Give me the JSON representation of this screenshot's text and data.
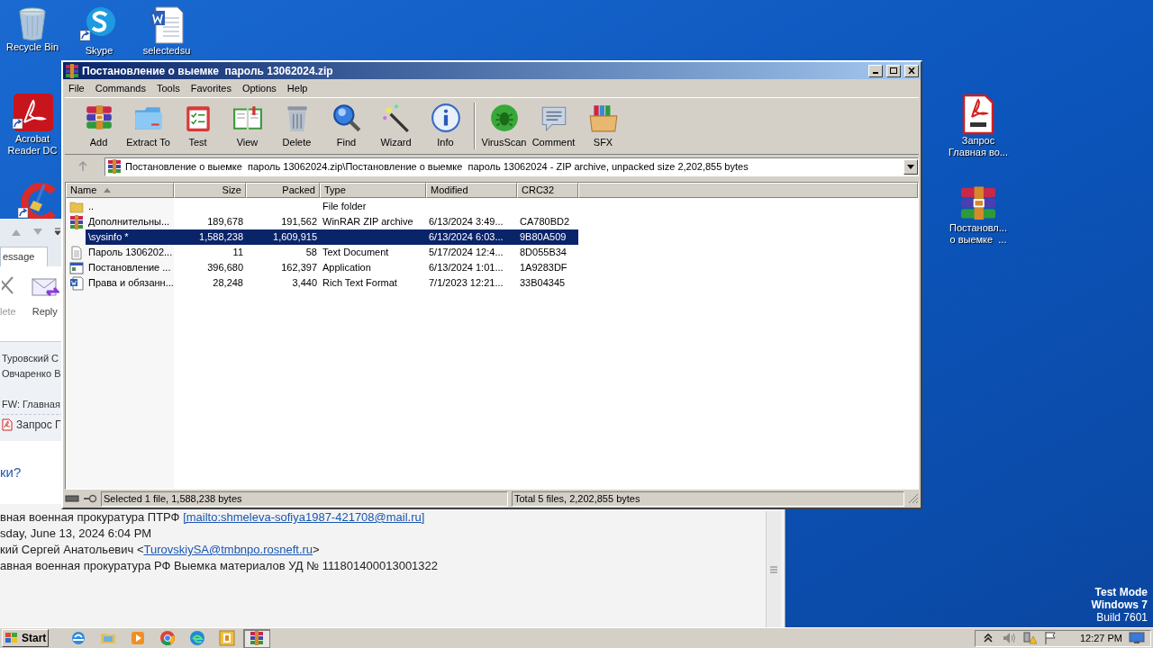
{
  "desktop_icons": [
    {
      "kind": "recycle",
      "lines": [
        "Recycle Bin"
      ]
    },
    {
      "kind": "skype",
      "lines": [
        "Skype"
      ]
    },
    {
      "kind": "word",
      "lines": [
        "selectedsu"
      ]
    },
    {
      "kind": "acrobat",
      "lines": [
        "Acrobat",
        "Reader DC"
      ]
    },
    {
      "kind": "ccleaner"
    },
    {
      "kind": "pdf",
      "lines": [
        "Запрос",
        "Главная во..."
      ]
    },
    {
      "kind": "rar",
      "lines": [
        "Постановл...",
        "о выемке  ..."
      ]
    }
  ],
  "mail_window": {
    "tabs": [
      {
        "label": "essage",
        "selected": true
      }
    ],
    "ribbon": [
      {
        "kind": "delete",
        "label": "lete"
      },
      {
        "kind": "reply",
        "label": "Reply"
      }
    ],
    "recipients": [
      "Туровский С",
      "Овчаренко В"
    ],
    "subject": "FW: Главная",
    "attachment": "Запрос Г",
    "heading": "ки?",
    "body": [
      {
        "text": "вная военная прокуратура ПТРФ ",
        "link": "[mailto:shmeleva-sofiya1987-421708@mail.ru]"
      },
      {
        "text": "sday, June 13, 2024 6:04 PM"
      },
      {
        "text": "кий Сергей Анатольевич <",
        "link": "TurovskiySA@tmbnpo.rosneft.ru",
        "after": ">"
      },
      {
        "text": "авная военная прокуратура РФ Выемка материалов УД № 111801400013001322"
      }
    ]
  },
  "archive_window": {
    "title": "Постановление о выемке  пароль 13062024.zip",
    "menu": [
      "File",
      "Commands",
      "Tools",
      "Favorites",
      "Options",
      "Help"
    ],
    "toolbar": [
      {
        "kind": "add",
        "label": "Add",
        "separator_before": false
      },
      {
        "kind": "extract",
        "label": "Extract To",
        "separator_before": false
      },
      {
        "kind": "test",
        "label": "Test",
        "separator_before": false
      },
      {
        "kind": "view",
        "label": "View",
        "separator_before": false
      },
      {
        "kind": "delete",
        "label": "Delete",
        "separator_before": false
      },
      {
        "kind": "find",
        "label": "Find",
        "separator_before": false
      },
      {
        "kind": "wizard",
        "label": "Wizard",
        "separator_before": false
      },
      {
        "kind": "info",
        "label": "Info",
        "separator_before": false
      },
      {
        "kind": "virus",
        "label": "VirusScan",
        "separator_before": true
      },
      {
        "kind": "comment",
        "label": "Comment",
        "separator_before": false
      },
      {
        "kind": "sfx",
        "label": "SFX",
        "separator_before": false
      }
    ],
    "address": "Постановление о выемке  пароль 13062024.zip\\Постановление о выемке  пароль 13062024 - ZIP archive, unpacked size 2,202,855 bytes",
    "columns": [
      {
        "label": "Name",
        "sorted": true
      },
      {
        "label": "Size",
        "sorted": false
      },
      {
        "label": "Packed",
        "sorted": false
      },
      {
        "label": "Type",
        "sorted": false
      },
      {
        "label": "Modified",
        "sorted": false
      },
      {
        "label": "CRC32",
        "sorted": false
      }
    ],
    "rows": [
      {
        "kind": "folder",
        "cells": [
          "..",
          "",
          "",
          "File folder",
          "",
          ""
        ],
        "selected": false
      },
      {
        "kind": "rar",
        "cells": [
          "Дополнительны...",
          "189,678",
          "191,562",
          "WinRAR ZIP archive",
          "6/13/2024 3:49...",
          "CA780BD2"
        ],
        "selected": false
      },
      {
        "kind": "none",
        "cells": [
          "\\sysinfo *",
          "1,588,238",
          "1,609,915",
          "",
          "6/13/2024 6:03...",
          "9B80A509"
        ],
        "selected": true
      },
      {
        "kind": "text",
        "cells": [
          "Пароль 1306202...",
          "11",
          "58",
          "Text Document",
          "5/17/2024 12:4...",
          "8D055B34"
        ],
        "selected": false
      },
      {
        "kind": "app",
        "cells": [
          "Постановление ...",
          "396,680",
          "162,397",
          "Application",
          "6/13/2024 1:01...",
          "1A9283DF"
        ],
        "selected": false
      },
      {
        "kind": "word",
        "cells": [
          "Права и обязанн...",
          "28,248",
          "3,440",
          "Rich Text Format",
          "7/1/2023 12:21...",
          "33B04345"
        ],
        "selected": false
      }
    ],
    "status_left": "Selected 1 file, 1,588,238 bytes",
    "status_right": "Total 5 files, 2,202,855 bytes"
  },
  "system_notice": [
    "Test Mode",
    "Windows 7",
    "Build 7601"
  ],
  "taskbar": {
    "start": "Start",
    "apps": [
      {
        "kind": "ie",
        "selected": false
      },
      {
        "kind": "explorer",
        "selected": false
      },
      {
        "kind": "media",
        "selected": false
      },
      {
        "kind": "chrome",
        "selected": false
      },
      {
        "kind": "edge",
        "selected": false
      },
      {
        "kind": "outlook",
        "selected": false
      },
      {
        "kind": "winrar",
        "selected": true
      }
    ],
    "tray": [
      {
        "kind": "up"
      },
      {
        "kind": "volume"
      },
      {
        "kind": "network"
      },
      {
        "kind": "flag"
      }
    ],
    "time": "12:27 PM"
  }
}
